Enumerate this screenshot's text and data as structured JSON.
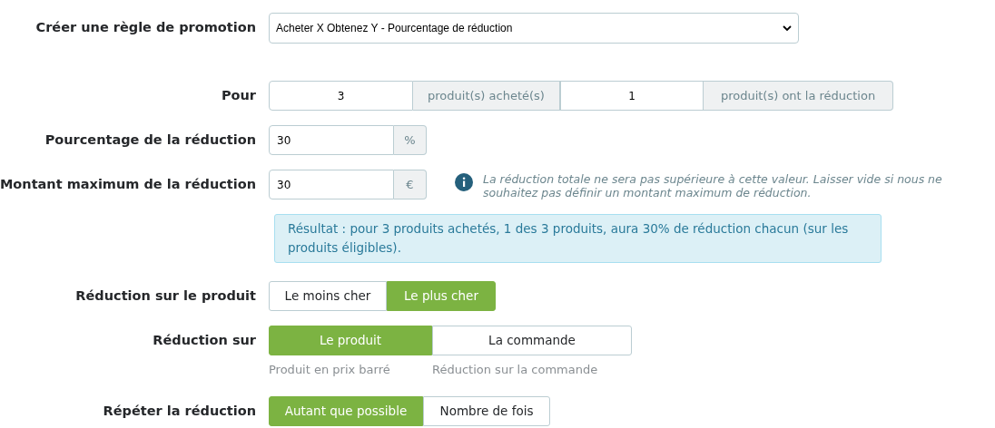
{
  "rows": [
    {
      "kind": "select",
      "label": "Créer une règle de promotion",
      "value": "Acheter X Obtenez Y - Pourcentage de réduction"
    },
    {
      "kind": "group",
      "label": "Pour",
      "parts": [
        {
          "kind": "input",
          "value": "3"
        },
        {
          "kind": "addon",
          "text": "produit(s) acheté(s)"
        },
        {
          "kind": "input",
          "value": "1"
        },
        {
          "kind": "addon",
          "text": "produit(s) ont la réduction"
        }
      ]
    },
    {
      "kind": "group",
      "label": "Pourcentage de la réduction",
      "parts": [
        {
          "kind": "input",
          "value": "30"
        },
        {
          "kind": "addon",
          "text": "%"
        }
      ]
    },
    {
      "kind": "group",
      "label": "Montant maximum de la réduction",
      "parts": [
        {
          "kind": "input",
          "value": "30"
        },
        {
          "kind": "addon",
          "text": "€"
        }
      ],
      "note": "La réduction totale ne sera pas supérieure à cette valeur. Laisser vide si nous ne souhaitez pas définir un montant maximum de réduction."
    },
    {
      "kind": "alert",
      "text": "Résultat : pour 3 produits achetés, 1 des 3 produits, aura 30% de réduction chacun (sur les produits éligibles)."
    },
    {
      "kind": "toggle",
      "label": "Réduction sur le produit",
      "options": [
        {
          "text": "Le moins cher",
          "selected": false
        },
        {
          "text": "Le plus cher",
          "selected": true
        }
      ]
    },
    {
      "kind": "toggle",
      "label": "Réduction sur",
      "options": [
        {
          "text": "Le produit",
          "selected": true,
          "hint": "Produit en prix barré"
        },
        {
          "text": "La commande",
          "selected": false,
          "hint": "Réduction sur la commande"
        }
      ]
    },
    {
      "kind": "toggle",
      "label": "Répéter la réduction",
      "options": [
        {
          "text": "Autant que possible",
          "selected": true
        },
        {
          "text": "Nombre de fois",
          "selected": false
        }
      ]
    }
  ]
}
